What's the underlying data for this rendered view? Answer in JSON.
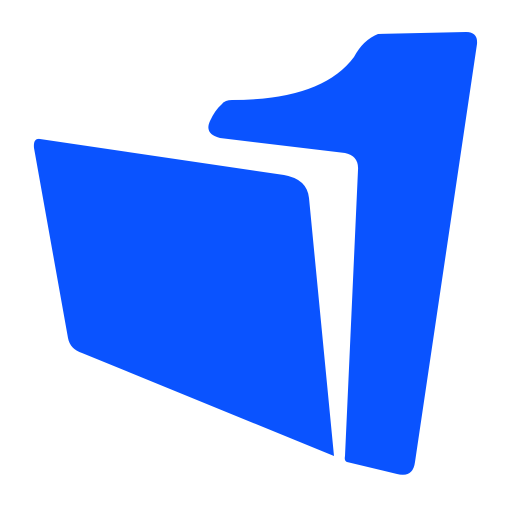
{
  "logo": {
    "name": "folder-one-logo",
    "brand_color": "#0A53FF",
    "background_color": "#FFFFFF"
  }
}
